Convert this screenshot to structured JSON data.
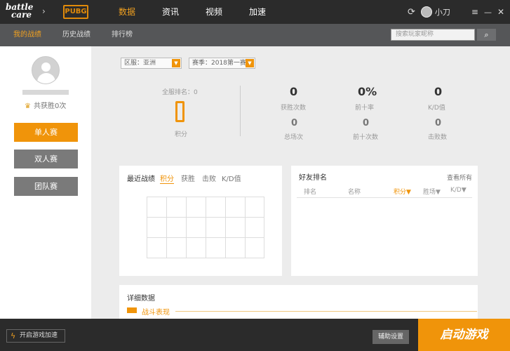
{
  "topbar": {
    "logo_line1": "battle",
    "logo_line2": "care",
    "game_logo": "PUBG",
    "nav": [
      "数据",
      "资讯",
      "视频",
      "加速"
    ],
    "active_nav": 0,
    "username": "小刀",
    "icons": [
      "refresh-icon",
      "avatar-icon",
      "menu-icon",
      "minimize-icon",
      "close-icon"
    ]
  },
  "subnav": {
    "tabs": [
      "我的战绩",
      "历史战绩",
      "排行榜"
    ],
    "active_tab": 0,
    "search_placeholder": "搜索玩家昵称"
  },
  "sidebar": {
    "wins_label": "共获胜0次",
    "modes": [
      "单人赛",
      "双人赛",
      "团队赛"
    ],
    "active_mode": 0
  },
  "filters": {
    "region": "区服：亚洲",
    "season": "赛季：2018第一赛季"
  },
  "stats": {
    "rank_label": "全服排名：0",
    "score_value": "0",
    "score_label": "积分",
    "items": [
      {
        "value": "0",
        "label": "获胜次数"
      },
      {
        "value": "0%",
        "label": "前十率"
      },
      {
        "value": "0",
        "label": "K/D值"
      },
      {
        "value": "0",
        "label": "总场次"
      },
      {
        "value": "0",
        "label": "前十次数"
      },
      {
        "value": "0",
        "label": "击败数"
      }
    ]
  },
  "recent": {
    "title": "最近战绩",
    "tabs": [
      "积分",
      "获胜",
      "击败",
      "K/D值"
    ],
    "active_tab": 0
  },
  "friends": {
    "title": "好友排名",
    "view_all": "查看所有",
    "columns": [
      "排名",
      "名称",
      "积分▼",
      "胜场▼",
      "K/D▼"
    ],
    "active_column": 2
  },
  "details": {
    "title": "详细数据",
    "sub": "战斗表现"
  },
  "bottombar": {
    "boost": "开启游戏加速",
    "assist": "辅助设置",
    "launch": "启动游戏"
  }
}
